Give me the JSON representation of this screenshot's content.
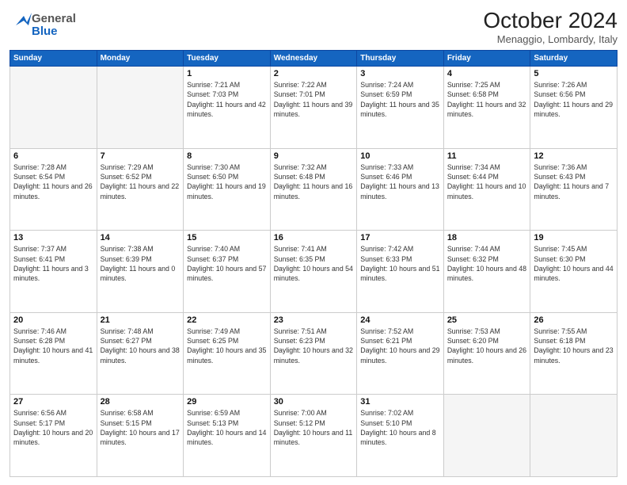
{
  "header": {
    "logo_general": "General",
    "logo_blue": "Blue",
    "title": "October 2024",
    "location": "Menaggio, Lombardy, Italy"
  },
  "days_of_week": [
    "Sunday",
    "Monday",
    "Tuesday",
    "Wednesday",
    "Thursday",
    "Friday",
    "Saturday"
  ],
  "weeks": [
    [
      {
        "day": "",
        "empty": true
      },
      {
        "day": "",
        "empty": true
      },
      {
        "day": "1",
        "sunrise": "7:21 AM",
        "sunset": "7:03 PM",
        "daylight": "11 hours and 42 minutes."
      },
      {
        "day": "2",
        "sunrise": "7:22 AM",
        "sunset": "7:01 PM",
        "daylight": "11 hours and 39 minutes."
      },
      {
        "day": "3",
        "sunrise": "7:24 AM",
        "sunset": "6:59 PM",
        "daylight": "11 hours and 35 minutes."
      },
      {
        "day": "4",
        "sunrise": "7:25 AM",
        "sunset": "6:58 PM",
        "daylight": "11 hours and 32 minutes."
      },
      {
        "day": "5",
        "sunrise": "7:26 AM",
        "sunset": "6:56 PM",
        "daylight": "11 hours and 29 minutes."
      }
    ],
    [
      {
        "day": "6",
        "sunrise": "7:28 AM",
        "sunset": "6:54 PM",
        "daylight": "11 hours and 26 minutes."
      },
      {
        "day": "7",
        "sunrise": "7:29 AM",
        "sunset": "6:52 PM",
        "daylight": "11 hours and 22 minutes."
      },
      {
        "day": "8",
        "sunrise": "7:30 AM",
        "sunset": "6:50 PM",
        "daylight": "11 hours and 19 minutes."
      },
      {
        "day": "9",
        "sunrise": "7:32 AM",
        "sunset": "6:48 PM",
        "daylight": "11 hours and 16 minutes."
      },
      {
        "day": "10",
        "sunrise": "7:33 AM",
        "sunset": "6:46 PM",
        "daylight": "11 hours and 13 minutes."
      },
      {
        "day": "11",
        "sunrise": "7:34 AM",
        "sunset": "6:44 PM",
        "daylight": "11 hours and 10 minutes."
      },
      {
        "day": "12",
        "sunrise": "7:36 AM",
        "sunset": "6:43 PM",
        "daylight": "11 hours and 7 minutes."
      }
    ],
    [
      {
        "day": "13",
        "sunrise": "7:37 AM",
        "sunset": "6:41 PM",
        "daylight": "11 hours and 3 minutes."
      },
      {
        "day": "14",
        "sunrise": "7:38 AM",
        "sunset": "6:39 PM",
        "daylight": "11 hours and 0 minutes."
      },
      {
        "day": "15",
        "sunrise": "7:40 AM",
        "sunset": "6:37 PM",
        "daylight": "10 hours and 57 minutes."
      },
      {
        "day": "16",
        "sunrise": "7:41 AM",
        "sunset": "6:35 PM",
        "daylight": "10 hours and 54 minutes."
      },
      {
        "day": "17",
        "sunrise": "7:42 AM",
        "sunset": "6:33 PM",
        "daylight": "10 hours and 51 minutes."
      },
      {
        "day": "18",
        "sunrise": "7:44 AM",
        "sunset": "6:32 PM",
        "daylight": "10 hours and 48 minutes."
      },
      {
        "day": "19",
        "sunrise": "7:45 AM",
        "sunset": "6:30 PM",
        "daylight": "10 hours and 44 minutes."
      }
    ],
    [
      {
        "day": "20",
        "sunrise": "7:46 AM",
        "sunset": "6:28 PM",
        "daylight": "10 hours and 41 minutes."
      },
      {
        "day": "21",
        "sunrise": "7:48 AM",
        "sunset": "6:27 PM",
        "daylight": "10 hours and 38 minutes."
      },
      {
        "day": "22",
        "sunrise": "7:49 AM",
        "sunset": "6:25 PM",
        "daylight": "10 hours and 35 minutes."
      },
      {
        "day": "23",
        "sunrise": "7:51 AM",
        "sunset": "6:23 PM",
        "daylight": "10 hours and 32 minutes."
      },
      {
        "day": "24",
        "sunrise": "7:52 AM",
        "sunset": "6:21 PM",
        "daylight": "10 hours and 29 minutes."
      },
      {
        "day": "25",
        "sunrise": "7:53 AM",
        "sunset": "6:20 PM",
        "daylight": "10 hours and 26 minutes."
      },
      {
        "day": "26",
        "sunrise": "7:55 AM",
        "sunset": "6:18 PM",
        "daylight": "10 hours and 23 minutes."
      }
    ],
    [
      {
        "day": "27",
        "sunrise": "6:56 AM",
        "sunset": "5:17 PM",
        "daylight": "10 hours and 20 minutes."
      },
      {
        "day": "28",
        "sunrise": "6:58 AM",
        "sunset": "5:15 PM",
        "daylight": "10 hours and 17 minutes."
      },
      {
        "day": "29",
        "sunrise": "6:59 AM",
        "sunset": "5:13 PM",
        "daylight": "10 hours and 14 minutes."
      },
      {
        "day": "30",
        "sunrise": "7:00 AM",
        "sunset": "5:12 PM",
        "daylight": "10 hours and 11 minutes."
      },
      {
        "day": "31",
        "sunrise": "7:02 AM",
        "sunset": "5:10 PM",
        "daylight": "10 hours and 8 minutes."
      },
      {
        "day": "",
        "empty": true
      },
      {
        "day": "",
        "empty": true
      }
    ]
  ]
}
